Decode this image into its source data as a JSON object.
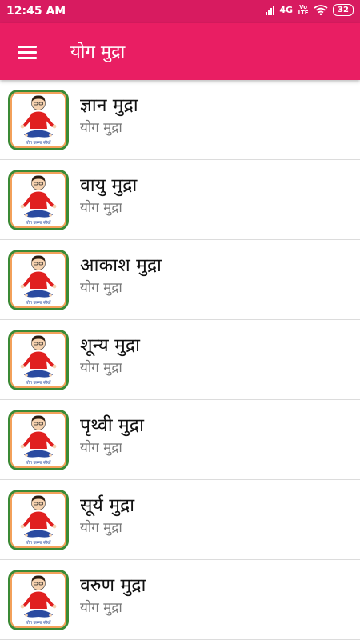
{
  "status": {
    "time": "12:45 AM",
    "network": "4G",
    "volte": "Vo LTE",
    "battery": "32"
  },
  "appbar": {
    "title": "योग मुद्रा",
    "menu_icon": "hamburger-menu-icon"
  },
  "items": [
    {
      "title": "ज्ञान मुद्रा",
      "subtitle": "योग मुद्रा",
      "badge": "योग करना सीखें"
    },
    {
      "title": "वायु मुद्रा",
      "subtitle": "योग मुद्रा",
      "badge": "योग करना सीखें"
    },
    {
      "title": "आकाश मुद्रा",
      "subtitle": "योग मुद्रा",
      "badge": "योग करना सीखें"
    },
    {
      "title": "शून्य मुद्रा",
      "subtitle": "योग मुद्रा",
      "badge": "योग करना सीखें"
    },
    {
      "title": "पृथ्वी मुद्रा",
      "subtitle": "योग मुद्रा",
      "badge": "योग करना सीखें"
    },
    {
      "title": "सूर्य मुद्रा",
      "subtitle": "योग मुद्रा",
      "badge": "योग करना सीखें"
    },
    {
      "title": "वरुण मुद्रा",
      "subtitle": "योग मुद्रा",
      "badge": "योग करना सीखें"
    }
  ],
  "colors": {
    "statusbar": "#d81b60",
    "appbar": "#e91e63",
    "frame": "#3a8a35",
    "figure_shirt": "#e02020",
    "figure_pants": "#2a4aa0"
  }
}
